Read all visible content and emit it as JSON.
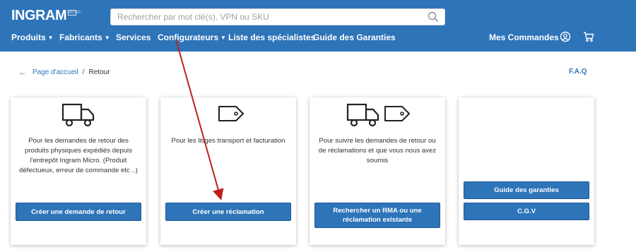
{
  "header": {
    "logo_text": "INGRAM",
    "logo_sub": "MICRO",
    "search_placeholder": "Rechercher par mot clé(s), VPN ou SKU",
    "nav": [
      {
        "label": "Produits",
        "caret": "▼"
      },
      {
        "label": "Fabricants",
        "caret": "▼"
      },
      {
        "label": "Services"
      },
      {
        "label": "Configurateurs",
        "caret": "▼"
      },
      {
        "label": "Liste des spécialistes"
      },
      {
        "label": "Guide des Garanties"
      }
    ],
    "orders_label": "Mes Commandes",
    "icons": [
      "user-icon",
      "cart-icon",
      "search-icon"
    ],
    "bg_color": "#2e74b9"
  },
  "breadcrumb": {
    "back_icon": "←",
    "home": "Page d'accueil",
    "separator": "/",
    "current": "Retour"
  },
  "faq_label": "F.A.Q",
  "cards": [
    {
      "icon": "truck-icon",
      "text": "Pour les demandes de retour des produits physiques expédiés depuis l'entrepôt Ingram Micro. (Produit défectueux, erreur de commande etc ..)",
      "button": "Créer une demande de retour"
    },
    {
      "icon": "tag-icon",
      "text": "Pour les litiges transport et facturation",
      "button": "Créer une réclamation"
    },
    {
      "icon": "truck-and-tag-icons",
      "text": "Pour suivre les demandes de retour ou de réclamations et que vous nous avez soumis",
      "button": "Rechercher un RMA ou une réclamation existante"
    },
    {
      "buttons": [
        "Guide des garanties",
        "C.G.V"
      ]
    }
  ],
  "annotation_color": "#c0201a"
}
